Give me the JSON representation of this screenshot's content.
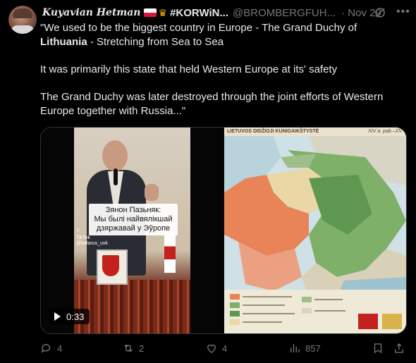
{
  "tweet": {
    "display_name": "Kuyavian Hetman",
    "name_tag": "#KORWiN...",
    "handle": "@BROMBERGFUH...",
    "date": "· Nov 29",
    "text": {
      "line1_pre": "\"We used to be the biggest country in Europe - The Grand Duchy of",
      "line2_bold": "Lithuania",
      "line2_post": " - Stretching from Sea to Sea",
      "para2": "It was primarily this state that held Western Europe at its' safety",
      "para3": "The Grand Duchy was later destroyed through the joint efforts of Western Europe together with Russia...\""
    }
  },
  "video": {
    "caption_line1": "Зянон Пазьняк:",
    "caption_line2": "Мы былі найвялікшай",
    "caption_line3": "дзяржавай у Эўропе",
    "tiktok_label": "TikTok",
    "tiktok_user": "@belarus_uvk",
    "duration": "0:33"
  },
  "map": {
    "title": "LIETUVOS DIDŽIOJI KUNIGAIKŠTYSTĖ",
    "corner": "XIV a. pab.–XV"
  },
  "actions": {
    "replies": "4",
    "reposts": "2",
    "likes": "4",
    "views": "857"
  },
  "colors": {
    "background": "#000000",
    "text": "#e7e9ea",
    "muted": "#71767b",
    "border": "#2f3336"
  },
  "icons": [
    "grok-icon",
    "more-icon",
    "play-icon",
    "reply-icon",
    "repost-icon",
    "like-icon",
    "views-icon",
    "bookmark-icon",
    "share-icon"
  ]
}
